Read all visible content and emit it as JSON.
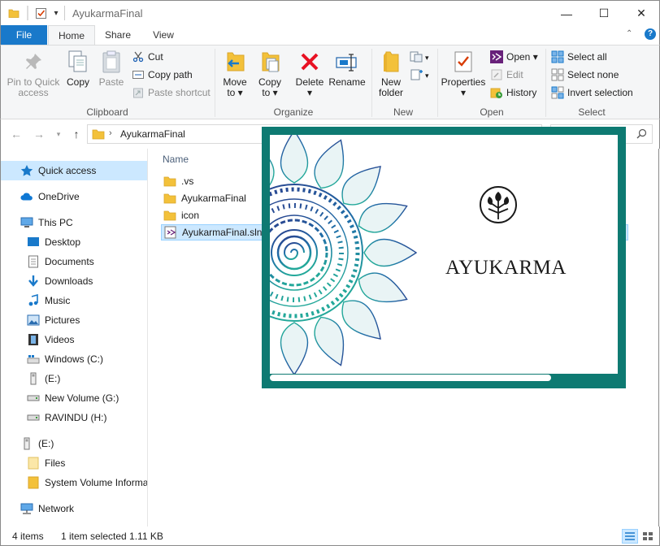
{
  "window": {
    "title": "AyukarmaFinal",
    "controls": [
      "—",
      "☐",
      "✕"
    ]
  },
  "ribbon_tabs": [
    {
      "label": "File"
    },
    {
      "label": "Home"
    },
    {
      "label": "Share"
    },
    {
      "label": "View"
    }
  ],
  "ribbon": {
    "clipboard": {
      "pin_label": "Pin to Quick access",
      "pin_line1": "Pin to Quick",
      "pin_line2": "access",
      "copy_label": "Copy",
      "paste_label": "Paste",
      "cut_label": "Cut",
      "copy_path_label": "Copy path",
      "paste_shortcut_label": "Paste shortcut",
      "group_label": "Clipboard"
    },
    "organize": {
      "move_line1": "Move",
      "move_line2": "to ▾",
      "copy_line1": "Copy",
      "copy_line2": "to ▾",
      "delete_line1": "Delete",
      "delete_line2": "▾",
      "rename_label": "Rename",
      "group_label": "Organize"
    },
    "new": {
      "new_folder_line1": "New",
      "new_folder_line2": "folder",
      "group_label": "New"
    },
    "open": {
      "properties_line1": "Properties",
      "properties_line2": "▾",
      "open_label": "Open ▾",
      "edit_label": "Edit",
      "history_label": "History",
      "group_label": "Open"
    },
    "select": {
      "select_all_label": "Select all",
      "select_none_label": "Select none",
      "invert_label": "Invert selection",
      "group_label": "Select"
    }
  },
  "address": {
    "breadcrumb": "AyukarmaFinal"
  },
  "nav_pane": {
    "items": [
      {
        "label": "Quick access"
      },
      {
        "label": "OneDrive"
      },
      {
        "label": "This PC"
      },
      {
        "label": "Desktop"
      },
      {
        "label": "Documents"
      },
      {
        "label": "Downloads"
      },
      {
        "label": "Music"
      },
      {
        "label": "Pictures"
      },
      {
        "label": "Videos"
      },
      {
        "label": "Windows (C:)"
      },
      {
        "label": "(E:)"
      },
      {
        "label": "New Volume (G:)"
      },
      {
        "label": "RAVINDU (H:)"
      },
      {
        "label": "(E:)"
      },
      {
        "label": "Files"
      },
      {
        "label": "System Volume Informa"
      },
      {
        "label": "Network"
      }
    ]
  },
  "content": {
    "column_name": "Name",
    "files": [
      {
        "name": ".vs",
        "type": "folder"
      },
      {
        "name": "AyukarmaFinal",
        "type": "folder"
      },
      {
        "name": "icon",
        "type": "folder"
      },
      {
        "name": "AyukarmaFinal.sln",
        "type": "solution"
      }
    ]
  },
  "preview": {
    "brand": "AYUKARMA",
    "frame_color": "#0e7a72",
    "mandala_color": "#1b4f8a",
    "mandala_accent": "#2aa39a"
  },
  "status_bar": {
    "item_count": "4 items",
    "selection": "1 item selected  1.11 KB"
  },
  "colors": {
    "accent": "#1979ca",
    "selection": "#cce8ff",
    "folder": "#f3c13a"
  }
}
